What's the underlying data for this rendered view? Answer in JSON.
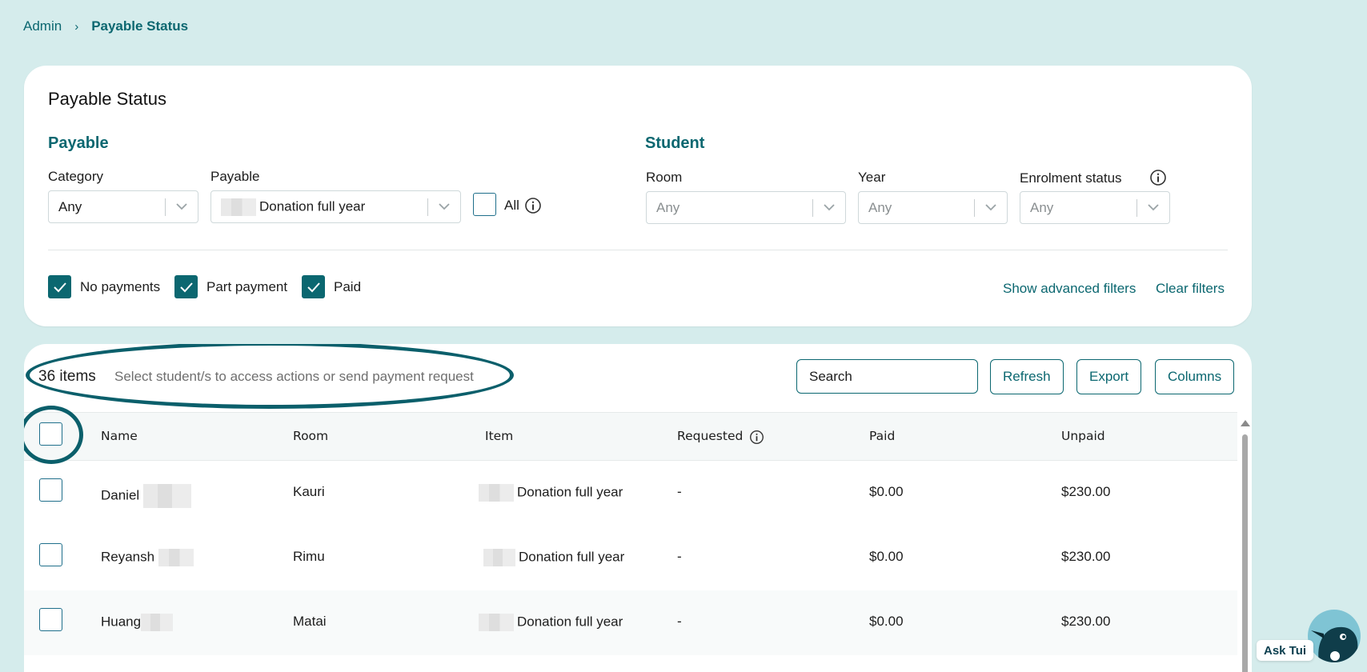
{
  "breadcrumb": {
    "parent": "Admin",
    "separator": "›",
    "current": "Payable Status"
  },
  "filters": {
    "title": "Payable Status",
    "payable_section": "Payable",
    "student_section": "Student",
    "category": {
      "label": "Category",
      "value": "Any"
    },
    "payable": {
      "label": "Payable",
      "value": "Donation full year"
    },
    "all_label": "All",
    "room": {
      "label": "Room",
      "placeholder": "Any"
    },
    "year": {
      "label": "Year",
      "placeholder": "Any"
    },
    "enrolment": {
      "label": "Enrolment status",
      "placeholder": "Any"
    },
    "status_checks": [
      {
        "label": "No payments",
        "checked": true
      },
      {
        "label": "Part payment",
        "checked": true
      },
      {
        "label": "Paid",
        "checked": true
      }
    ],
    "show_advanced": "Show advanced filters",
    "clear": "Clear filters"
  },
  "toolbar": {
    "count": "36 items",
    "hint": "Select student/s to access actions or send payment request",
    "search_placeholder": "Search",
    "refresh": "Refresh",
    "export": "Export",
    "columns": "Columns"
  },
  "table": {
    "headers": {
      "name": "Name",
      "room": "Room",
      "item": "Item",
      "requested": "Requested",
      "paid": "Paid",
      "unpaid": "Unpaid"
    },
    "rows": [
      {
        "name": "Daniel",
        "room": "Kauri",
        "item": "Donation full year",
        "requested": "-",
        "paid": "$0.00",
        "unpaid": "$230.00"
      },
      {
        "name": "Reyansh",
        "room": "Rimu",
        "item": "Donation full year",
        "requested": "-",
        "paid": "$0.00",
        "unpaid": "$230.00"
      },
      {
        "name": "Huang",
        "room": "Matai",
        "item": "Donation full year",
        "requested": "-",
        "paid": "$0.00",
        "unpaid": "$230.00"
      }
    ]
  },
  "assistant": {
    "label": "Ask Tui"
  },
  "colors": {
    "accent": "#0b6770",
    "background": "#d5ecec"
  }
}
